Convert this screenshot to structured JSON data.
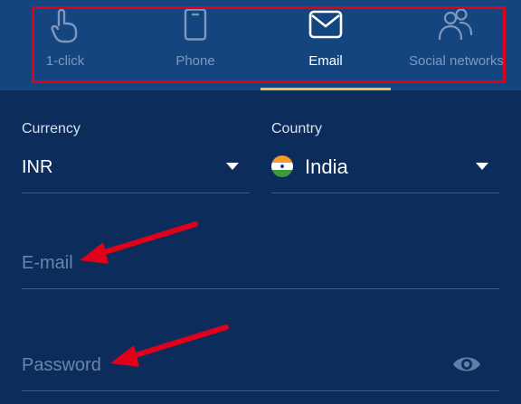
{
  "tabs": [
    {
      "label": "1-click",
      "icon": "hand-pointer-icon",
      "active": false
    },
    {
      "label": "Phone",
      "icon": "phone-icon",
      "active": false
    },
    {
      "label": "Email",
      "icon": "envelope-icon",
      "active": true
    },
    {
      "label": "Social networks",
      "icon": "people-icon",
      "active": false
    }
  ],
  "form": {
    "currency_label": "Currency",
    "currency_value": "INR",
    "country_label": "Country",
    "country_value": "India",
    "email_placeholder": "E-mail",
    "password_placeholder": "Password"
  },
  "colors": {
    "background": "#0c2d5c",
    "tabbar": "#15457f",
    "active_tab_indicator": "#e8c547",
    "annotation_red": "#e0001a"
  }
}
